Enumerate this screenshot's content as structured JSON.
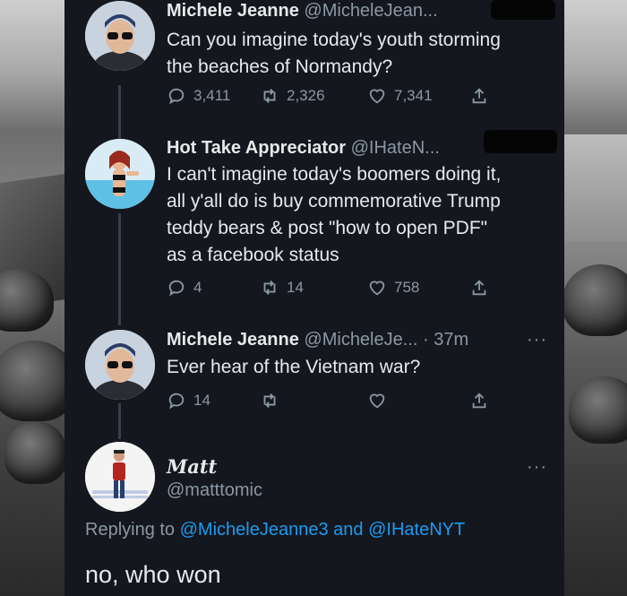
{
  "tweets": [
    {
      "name": "Michele Jeanne",
      "handle": "@MicheleJean...",
      "text_lines": [
        "Can you imagine today's youth storming",
        "the beaches of Normandy?"
      ],
      "replies": "3,411",
      "retweets": "2,326",
      "likes": "7,341"
    },
    {
      "name": "Hot Take Appreciator",
      "handle": "@IHateN...",
      "text_lines": [
        "I can't imagine today's boomers doing it,",
        "all y'all do is buy commemorative Trump",
        "teddy bears & post \"how to open PDF\"",
        "as a facebook status"
      ],
      "replies": "4",
      "retweets": "14",
      "likes": "758"
    },
    {
      "name": "Michele Jeanne",
      "handle": "@MicheleJe...",
      "time": "· 37m",
      "text_lines": [
        "Ever hear of the Vietnam war?"
      ],
      "replies": "14"
    }
  ],
  "reply": {
    "name": "Matt",
    "handle": "@matttomic",
    "replying_prefix": "Replying to",
    "replying_to_1": "@MicheleJeanne3",
    "replying_and": "and",
    "replying_to_2": "@IHateNYT",
    "text": "no, who won"
  },
  "more_label": "···",
  "icons": [
    "reply-icon",
    "retweet-icon",
    "like-icon",
    "share-icon",
    "more-icon"
  ],
  "colors": {
    "panel": "#14171e",
    "text": "#e7e9ea",
    "muted": "#8b98a5",
    "link": "#1d9bf0"
  }
}
